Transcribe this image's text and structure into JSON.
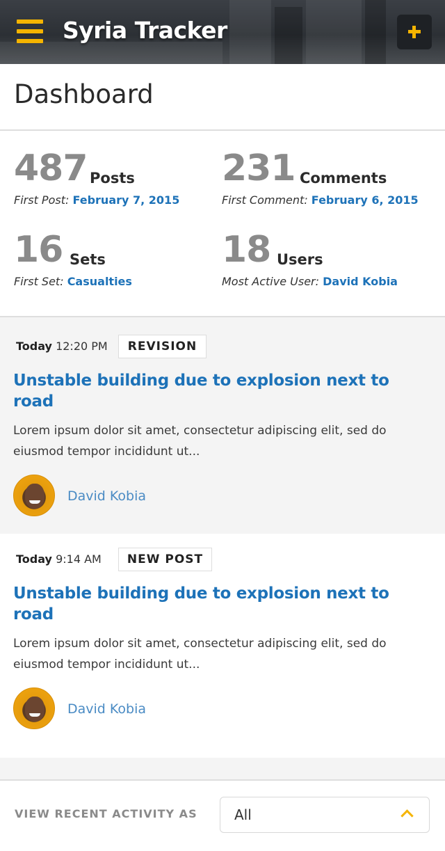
{
  "header": {
    "title": "Syria Tracker",
    "menu_icon": "hamburger-menu-icon",
    "add_icon": "plus-icon",
    "accent_color": "#f5b400"
  },
  "page": {
    "title": "Dashboard"
  },
  "stats": [
    {
      "number": "487",
      "label": "Posts",
      "sub_label": "First Post:",
      "sub_value": "February 7, 2015"
    },
    {
      "number": "231",
      "label": "Comments",
      "sub_label": "First Comment:",
      "sub_value": "February 6, 2015"
    },
    {
      "number": "16",
      "label": "Sets",
      "sub_label": "First Set:",
      "sub_value": "Casualties"
    },
    {
      "number": "18",
      "label": "Users",
      "sub_label": "Most Active User:",
      "sub_value": "David Kobia"
    }
  ],
  "activity": [
    {
      "day": "Today",
      "time": "12:20 PM",
      "badge": "REVISION",
      "title": "Unstable building due to explosion next to road",
      "excerpt": "Lorem ipsum dolor sit amet, consectetur adipiscing elit, sed do eiusmod tempor incididunt ut...",
      "author": "David Kobia"
    },
    {
      "day": "Today",
      "time": "9:14 AM",
      "badge": "NEW POST",
      "title": "Unstable building due to explosion next to road",
      "excerpt": "Lorem ipsum dolor sit amet, consectetur adipiscing elit, sed do eiusmod tempor incididunt ut...",
      "author": "David Kobia"
    }
  ],
  "footer": {
    "label": "VIEW RECENT ACTIVITY AS",
    "select_value": "All",
    "select_icon": "chevron-up-icon"
  },
  "colors": {
    "link": "#1d72b8",
    "author_link": "#4a8bc4",
    "stat_number": "#8a8a8a"
  }
}
